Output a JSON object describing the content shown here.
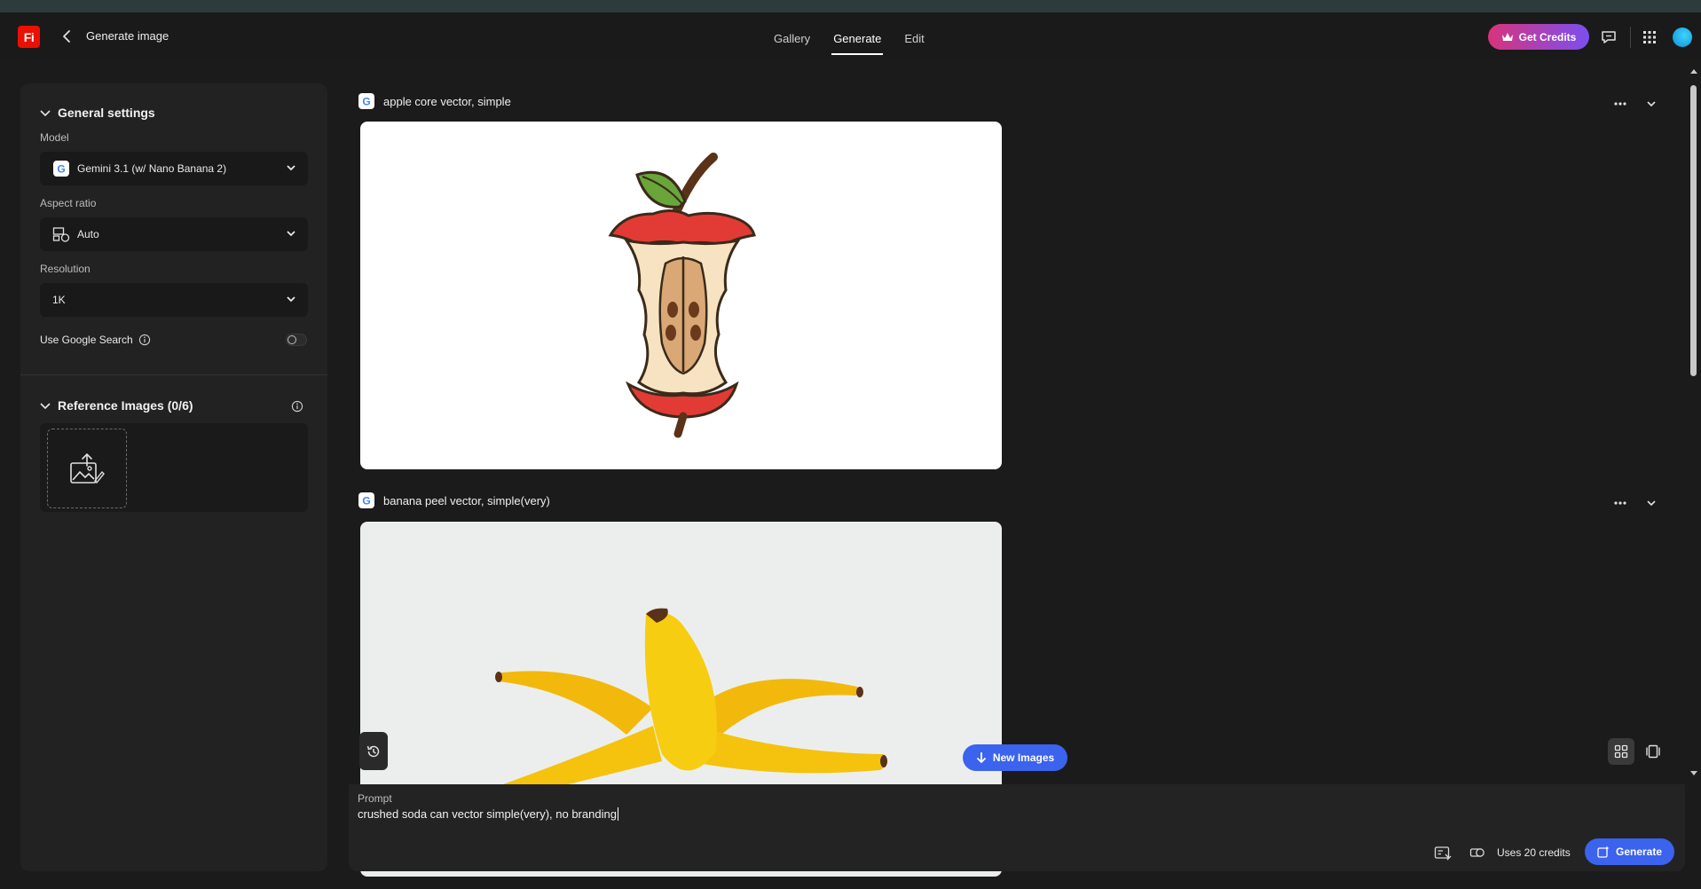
{
  "header": {
    "logo": "Fi",
    "title": "Generate image",
    "tabs": [
      {
        "label": "Gallery",
        "active": false
      },
      {
        "label": "Generate",
        "active": true
      },
      {
        "label": "Edit",
        "active": false
      }
    ],
    "credits_button": "Get Credits"
  },
  "settings": {
    "general_title": "General settings",
    "model_label": "Model",
    "model_value": "Gemini 3.1 (w/ Nano Banana 2)",
    "aspect_label": "Aspect ratio",
    "aspect_value": "Auto",
    "resolution_label": "Resolution",
    "resolution_value": "1K",
    "google_search_label": "Use Google Search",
    "google_search_enabled": false,
    "reference_title": "Reference Images (0/6)"
  },
  "results": [
    {
      "prompt": "apple core vector, simple"
    },
    {
      "prompt": "banana peel vector, simple(very)"
    }
  ],
  "controls": {
    "new_images": "New Images"
  },
  "prompt_bar": {
    "label": "Prompt",
    "value": "crushed soda can vector simple(very), no branding",
    "uses_credits": "Uses 20 credits",
    "generate_button": "Generate"
  },
  "colors": {
    "accent_blue": "#3b63ee",
    "logo_red": "#eb1000",
    "credits_gradient_start": "#d8347b",
    "credits_gradient_end": "#7a4ff0"
  }
}
